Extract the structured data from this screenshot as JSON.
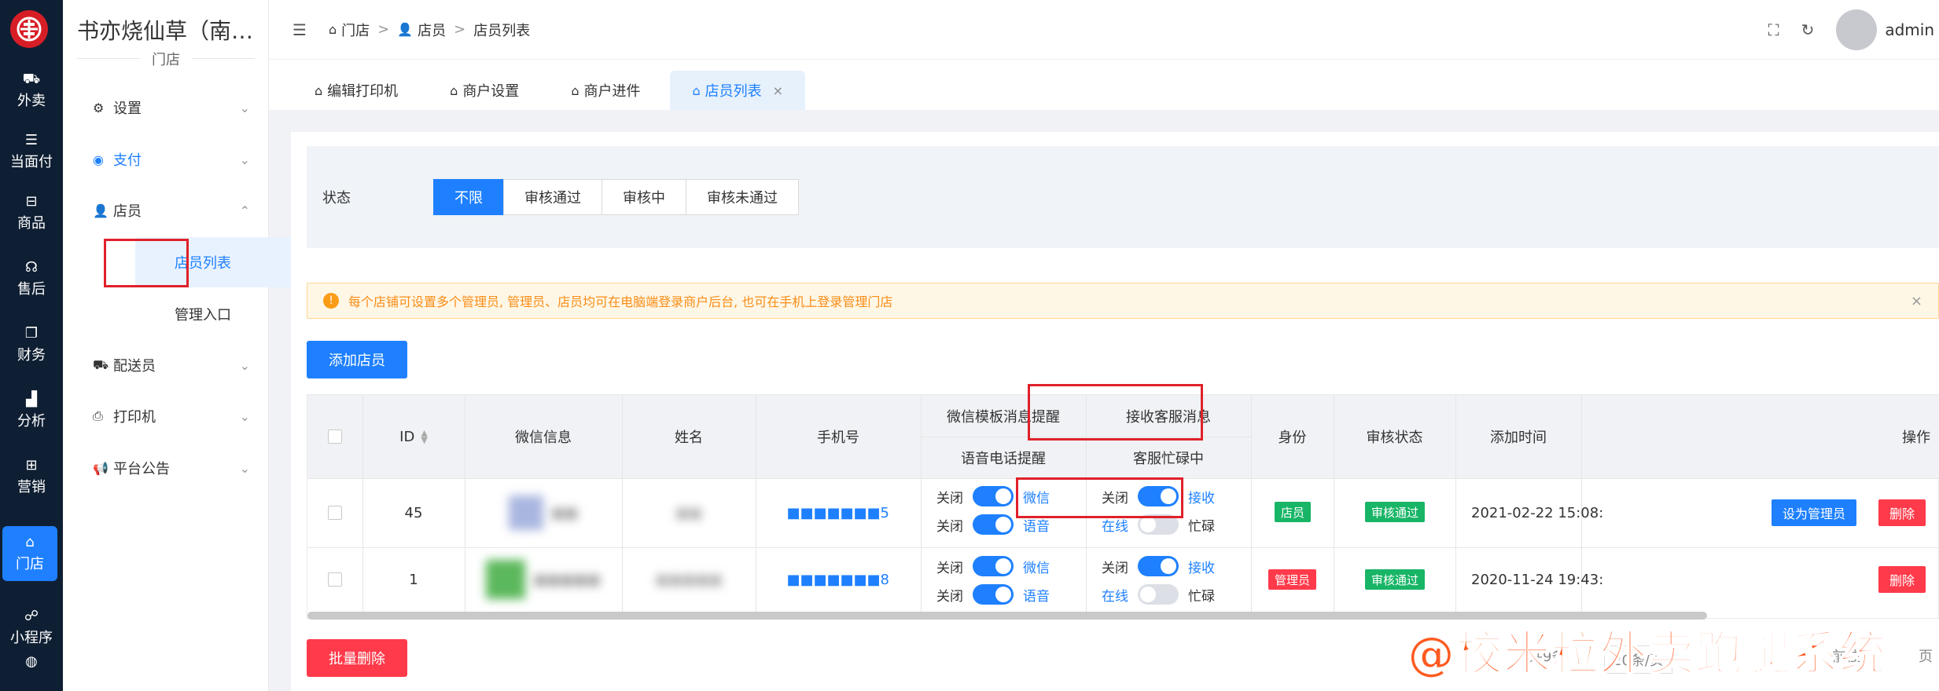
{
  "rail": {
    "items": [
      {
        "icon": "scooter-icon",
        "glyph": "⛟",
        "label": "外卖"
      },
      {
        "icon": "list-icon",
        "glyph": "☰",
        "label": "当面付"
      },
      {
        "icon": "gift-icon",
        "glyph": "⊟",
        "label": "商品"
      },
      {
        "icon": "headset-icon",
        "glyph": "☊",
        "label": "售后"
      },
      {
        "icon": "copy-icon",
        "glyph": "❐",
        "label": "财务"
      },
      {
        "icon": "bar-chart-icon",
        "glyph": "▟",
        "label": "分析"
      },
      {
        "icon": "gift-box-icon",
        "glyph": "⊞",
        "label": "营销"
      },
      {
        "icon": "store-icon",
        "glyph": "⌂",
        "label": "门店"
      },
      {
        "icon": "wechat-icon",
        "glyph": "☍",
        "label": "小程序"
      },
      {
        "icon": "compass-icon",
        "glyph": "◍",
        "label": ""
      }
    ]
  },
  "sidebar": {
    "shop_name": "书亦烧仙草（南…",
    "shop_sub": "门店",
    "menu": [
      {
        "label": "设置",
        "glyph": "⚙"
      },
      {
        "label": "支付",
        "glyph": "◉"
      },
      {
        "label": "店员",
        "glyph": "👤"
      },
      {
        "label": "配送员",
        "glyph": "⛟"
      },
      {
        "label": "打印机",
        "glyph": "⎙"
      },
      {
        "label": "平台公告",
        "glyph": "📢"
      }
    ],
    "submenu": [
      {
        "label": "店员列表"
      },
      {
        "label": "管理入口"
      }
    ]
  },
  "topbar": {
    "fold_glyph": "☰",
    "crumbs": [
      "门店",
      "店员",
      "店员列表"
    ],
    "user": "admin"
  },
  "tabs": [
    {
      "label": "编辑打印机"
    },
    {
      "label": "商户设置"
    },
    {
      "label": "商户进件"
    },
    {
      "label": "店员列表"
    }
  ],
  "filter": {
    "label": "状态",
    "options": [
      "不限",
      "审核通过",
      "审核中",
      "审核未通过"
    ],
    "selected": "不限"
  },
  "alert": {
    "text": "每个店铺可设置多个管理员, 管理员、店员均可在电脑端登录商户后台, 也可在手机上登录管理门店"
  },
  "buttons": {
    "add": "添加店员",
    "batch_delete": "批量删除"
  },
  "table": {
    "headers": {
      "id": "ID",
      "wechat": "微信信息",
      "name": "姓名",
      "phone": "手机号",
      "tpl_msg": "微信模板消息提醒",
      "voice": "语音电话提醒",
      "cs_msg": "接收客服消息",
      "cs_busy": "客服忙碌中",
      "role": "身份",
      "status": "审核状态",
      "time": "添加时间",
      "ops": "操作"
    },
    "rows": [
      {
        "id": "45",
        "wechat": "■■",
        "name": "■■",
        "phone": "■■■■■■■5",
        "tpl": {
          "off": "关闭",
          "on": "微信",
          "state": true
        },
        "voice": {
          "off": "关闭",
          "on": "语音",
          "state": true
        },
        "cs": {
          "off": "关闭",
          "on": "接收",
          "state": true
        },
        "busy": {
          "off": "在线",
          "on": "忙碌",
          "state": false
        },
        "role": "店员",
        "status": "审核通过",
        "time": "2021-02-22 15:08:",
        "op_set": "设为管理员",
        "op_del": "删除"
      },
      {
        "id": "1",
        "wechat": "■■■■■",
        "name": "■■■■■",
        "phone": "■■■■■■■8",
        "tpl": {
          "off": "关闭",
          "on": "微信",
          "state": true
        },
        "voice": {
          "off": "关闭",
          "on": "语音",
          "state": true
        },
        "cs": {
          "off": "关闭",
          "on": "接收",
          "state": true
        },
        "busy": {
          "off": "在线",
          "on": "忙碌",
          "state": false
        },
        "role": "管理员",
        "status": "审核通过",
        "time": "2020-11-24 19:43:",
        "op_del": "删除"
      }
    ]
  },
  "pager": {
    "total": "共9条",
    "per_page": "20条/页",
    "jump": "前往",
    "page_suffix": "页"
  },
  "watermark": "@校米粒外卖跑腿系统",
  "colors": {
    "primary": "#1e80ff",
    "danger": "#ff3a4a",
    "success": "#18b566",
    "rail_bg": "#0f1f33",
    "warning": "#fa8c16"
  }
}
